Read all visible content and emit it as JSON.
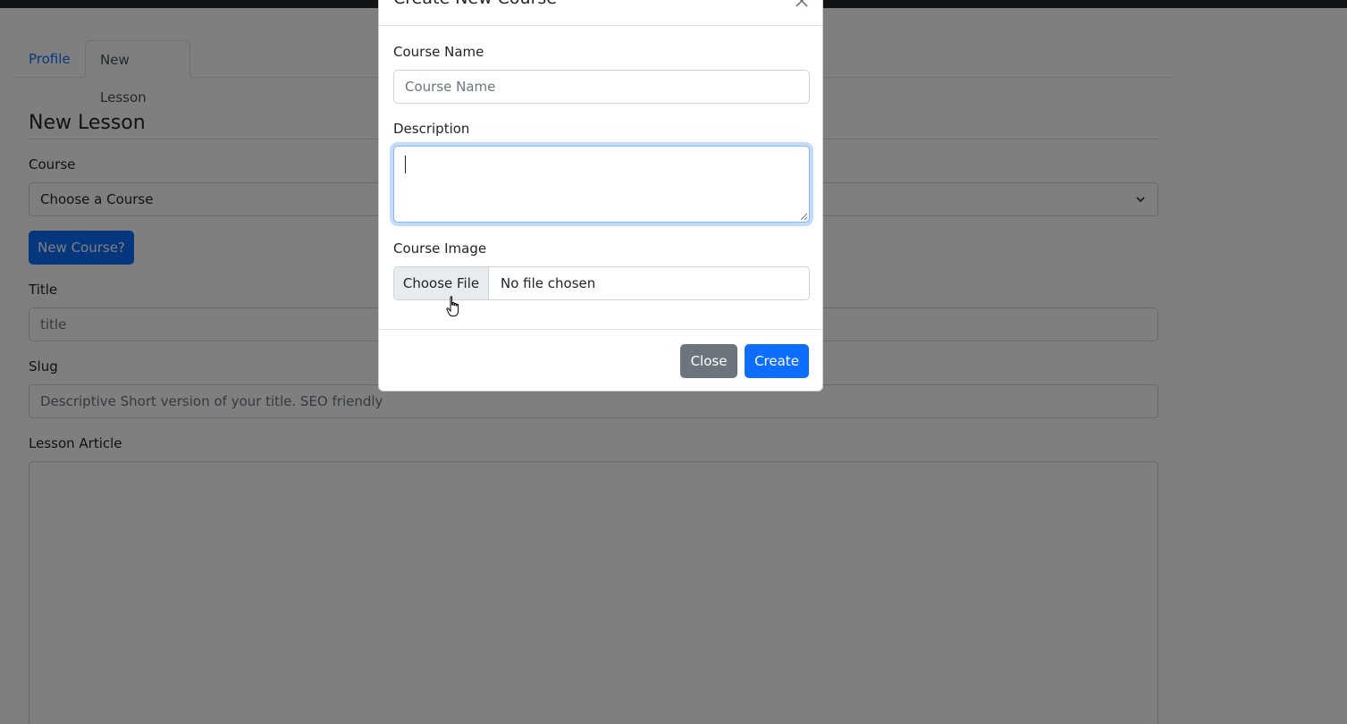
{
  "tabs": [
    {
      "label": "Profile"
    },
    {
      "label": "New Lesson"
    }
  ],
  "form": {
    "section_title": "New Lesson",
    "course_label": "Course",
    "course_select_value": "Choose a Course",
    "new_course_button": "New Course?",
    "title_label": "Title",
    "title_placeholder": "title",
    "slug_label": "Slug",
    "slug_placeholder": "Descriptive Short version of your title. SEO friendly",
    "article_label": "Lesson Article"
  },
  "modal": {
    "title": "Create New Course",
    "course_name_label": "Course Name",
    "course_name_placeholder": "Course Name",
    "description_label": "Description",
    "description_value": "",
    "course_image_label": "Course Image",
    "choose_file_button": "Choose File",
    "file_status": "No file chosen",
    "close_button": "Close",
    "create_button": "Create"
  },
  "colors": {
    "primary": "#0d6efd",
    "secondary": "#6c757d",
    "navbar": "#212529"
  }
}
